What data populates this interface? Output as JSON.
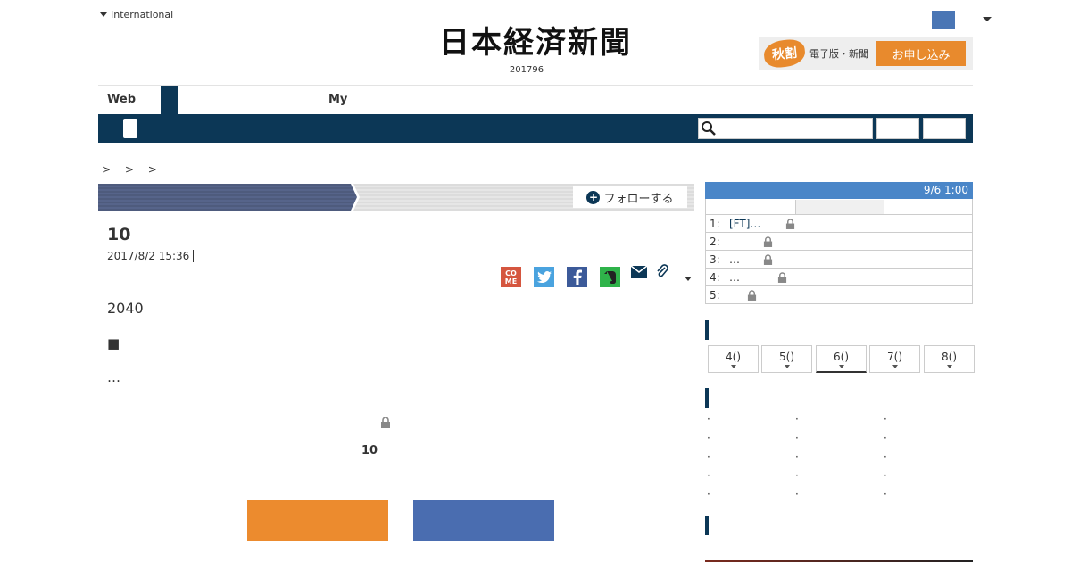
{
  "header": {
    "international_label": "International",
    "logo_text": "日本経済新聞",
    "logo_sub": "201796",
    "promo": {
      "badge": "秋割",
      "text": "電子版・新聞",
      "button": "お申し込み"
    }
  },
  "nav": {
    "tabs": [
      "Web",
      "My"
    ],
    "search_placeholder": ""
  },
  "breadcrumb": "> > >",
  "article": {
    "follow_label": "フォローする",
    "headline": "10",
    "date": "2017/8/2 15:36",
    "share": {
      "come_top": "CO",
      "come_bottom": "ME"
    },
    "paragraphs": [
      "2040",
      "■",
      "…"
    ],
    "paywall_number": "10"
  },
  "sidebar": {
    "ranking_time": "9/6 1:00",
    "ranking": [
      {
        "rank": "1:",
        "text": "[FT]…",
        "locked": true
      },
      {
        "rank": "2:",
        "text": "",
        "locked": true
      },
      {
        "rank": "3:",
        "text": "…",
        "locked": true
      },
      {
        "rank": "4:",
        "text": "…",
        "locked": true
      },
      {
        "rank": "5:",
        "text": "",
        "locked": true
      }
    ],
    "days": [
      "4()",
      "5()",
      "6()",
      "7()",
      "8()"
    ],
    "selected_day": "6()"
  },
  "colors": {
    "navy": "#0c3756",
    "orange": "#ec8b2e",
    "blue": "#4a6db0",
    "ranking_blue": "#4a86c8"
  }
}
